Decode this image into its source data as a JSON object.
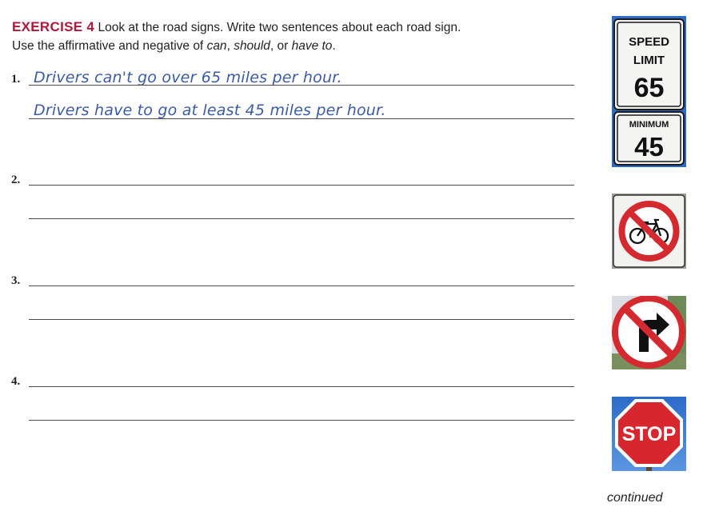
{
  "exercise": {
    "title": "EXERCISE 4",
    "instruction_line1": "Look at the road signs. Write two sentences about each road sign.",
    "instruction_line2_pre": "Use the affirmative and negative of ",
    "word_can": "can",
    "sep1": ", ",
    "word_should": "should",
    "sep2": ", or ",
    "word_have_to": "have to",
    "end": "."
  },
  "items": [
    {
      "number": "1.",
      "answers": [
        "Drivers can't go over 65 miles per hour.",
        "Drivers have to go at least 45 miles per hour."
      ]
    },
    {
      "number": "2.",
      "answers": [
        "",
        ""
      ]
    },
    {
      "number": "3.",
      "answers": [
        "",
        ""
      ]
    },
    {
      "number": "4.",
      "answers": [
        "",
        ""
      ]
    }
  ],
  "signs": {
    "speed_limit": {
      "line1": "SPEED",
      "line2": "LIMIT",
      "value": "65"
    },
    "minimum": {
      "label": "MINIMUM",
      "value": "45"
    },
    "stop": {
      "text": "STOP"
    }
  },
  "continued": "continued",
  "colors": {
    "accent": "#b0173a",
    "handwriting": "#3b5aa8",
    "stop_red": "#d8262f",
    "sky": "#2d6bc9"
  }
}
